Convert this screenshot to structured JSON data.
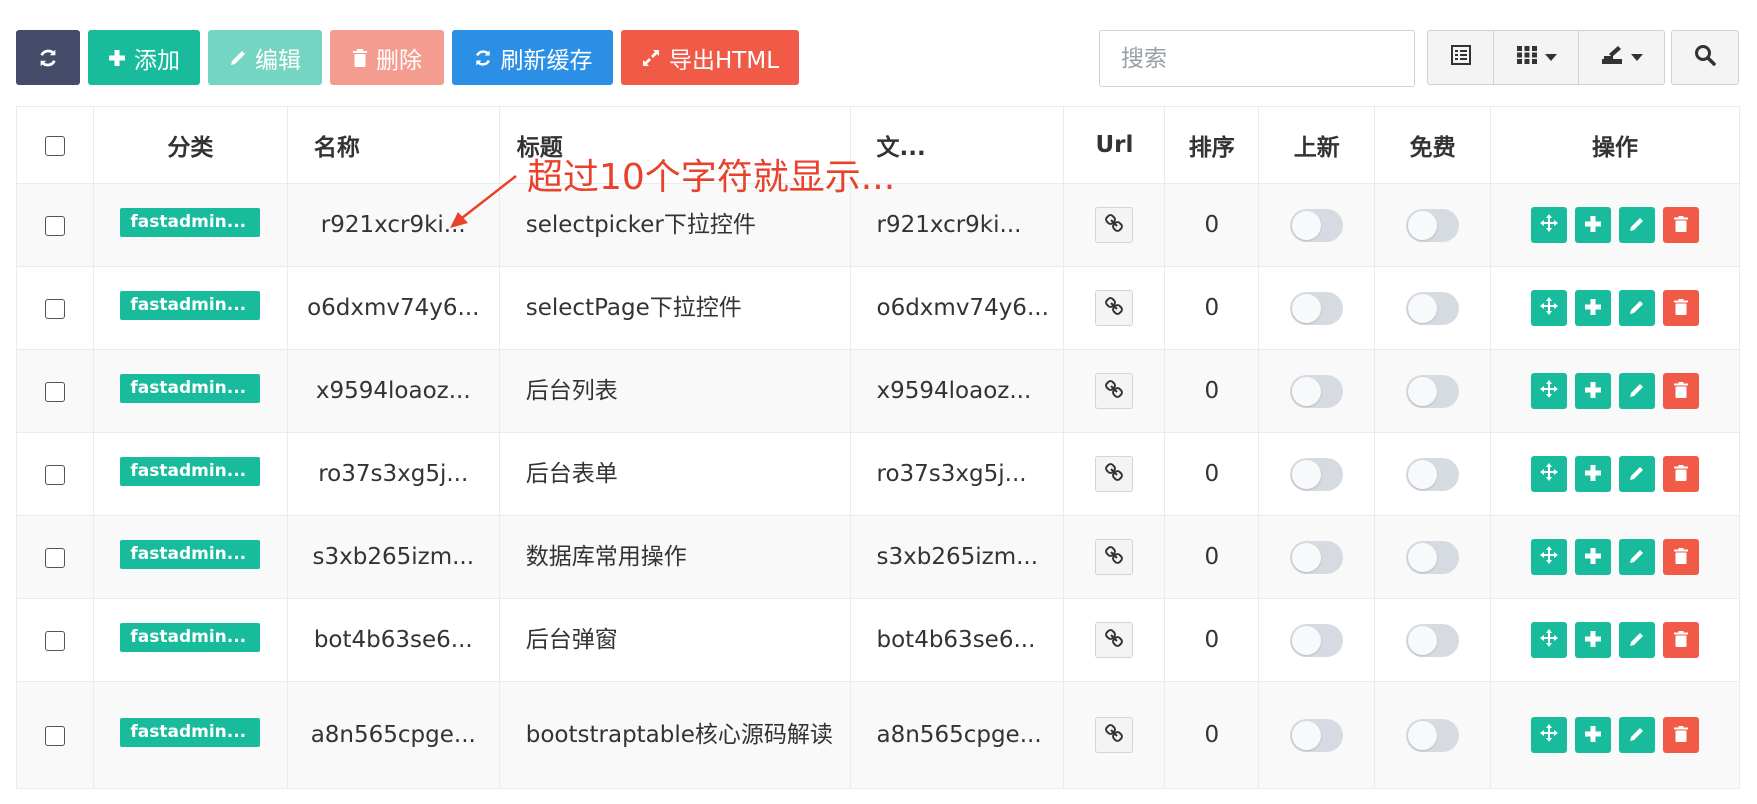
{
  "toolbar": {
    "add_label": "添加",
    "edit_label": "编辑",
    "delete_label": "删除",
    "refresh_cache_label": "刷新缓存",
    "export_label": "导出HTML"
  },
  "search": {
    "placeholder": "搜索"
  },
  "table": {
    "headers": {
      "category": "分类",
      "name": "名称",
      "title": "标题",
      "file": "文...",
      "url": "Url",
      "sort": "排序",
      "is_new": "上新",
      "free": "免费",
      "actions": "操作"
    },
    "rows": [
      {
        "category": "fastadmin...",
        "name": "r921xcr9ki...",
        "title": "selectpicker下拉控件",
        "file": "r921xcr9ki...",
        "sort": "0"
      },
      {
        "category": "fastadmin...",
        "name": "o6dxmv74y6...",
        "title": "selectPage下拉控件",
        "file": "o6dxmv74y6...",
        "sort": "0"
      },
      {
        "category": "fastadmin...",
        "name": "x9594loaoz...",
        "title": "后台列表",
        "file": "x9594loaoz...",
        "sort": "0"
      },
      {
        "category": "fastadmin...",
        "name": "ro37s3xg5j...",
        "title": "后台表单",
        "file": "ro37s3xg5j...",
        "sort": "0"
      },
      {
        "category": "fastadmin...",
        "name": "s3xb265izm...",
        "title": "数据库常用操作",
        "file": "s3xb265izm...",
        "sort": "0"
      },
      {
        "category": "fastadmin...",
        "name": "bot4b63se6...",
        "title": "后台弹窗",
        "file": "bot4b63se6...",
        "sort": "0"
      },
      {
        "category": "fastadmin...",
        "name": "a8n565cpge...",
        "title": "bootstraptable核心源码解读",
        "file": "a8n565cpge...",
        "sort": "0"
      }
    ]
  },
  "annotation": {
    "text": "超过10个字符就显示..."
  },
  "colors": {
    "primary": "#18bc9c",
    "danger": "#f05a47",
    "info": "#2c8fe6",
    "dark": "#444c69",
    "annotation": "#e8412c"
  }
}
